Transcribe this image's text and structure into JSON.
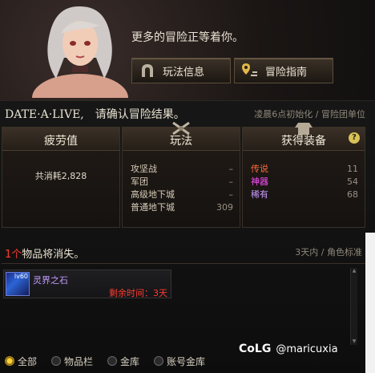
{
  "header": {
    "message": "更多的冒险正等着你。",
    "buttons": [
      {
        "label": "玩法信息",
        "icon": "horseshoe-icon"
      },
      {
        "label": "冒险指南",
        "icon": "map-pin-icon"
      }
    ]
  },
  "result": {
    "title": "DATE·A·LIVE,　请确认冒险结果。",
    "note": "凌晨6点初始化 / 冒险团单位"
  },
  "panels": {
    "fatigue": {
      "title": "疲劳值",
      "total": "共消耗2,828"
    },
    "gameplay": {
      "title": "玩法",
      "rows": [
        {
          "label": "攻坚战",
          "value": "–"
        },
        {
          "label": "军团",
          "value": "–"
        },
        {
          "label": "高级地下城",
          "value": "–"
        },
        {
          "label": "普通地下城",
          "value": "309"
        }
      ]
    },
    "loot": {
      "title": "获得装备",
      "help": "?",
      "rows": [
        {
          "label": "传说",
          "value": "11"
        },
        {
          "label": "神器",
          "value": "54"
        },
        {
          "label": "稀有",
          "value": "68"
        }
      ]
    }
  },
  "vanish": {
    "count": "1个",
    "title_rest": "物品将消失。",
    "note": "3天内 / 角色标准",
    "items": [
      {
        "name": "灵界之石",
        "level": "lv60",
        "time": "剩余时间：3天"
      }
    ]
  },
  "tabs": [
    {
      "label": "全部",
      "selected": true
    },
    {
      "label": "物品栏",
      "selected": false
    },
    {
      "label": "金库",
      "selected": false
    },
    {
      "label": "账号金库",
      "selected": false
    }
  ],
  "watermark": {
    "brand": "CoLG",
    "handle": "@maricuxia"
  }
}
